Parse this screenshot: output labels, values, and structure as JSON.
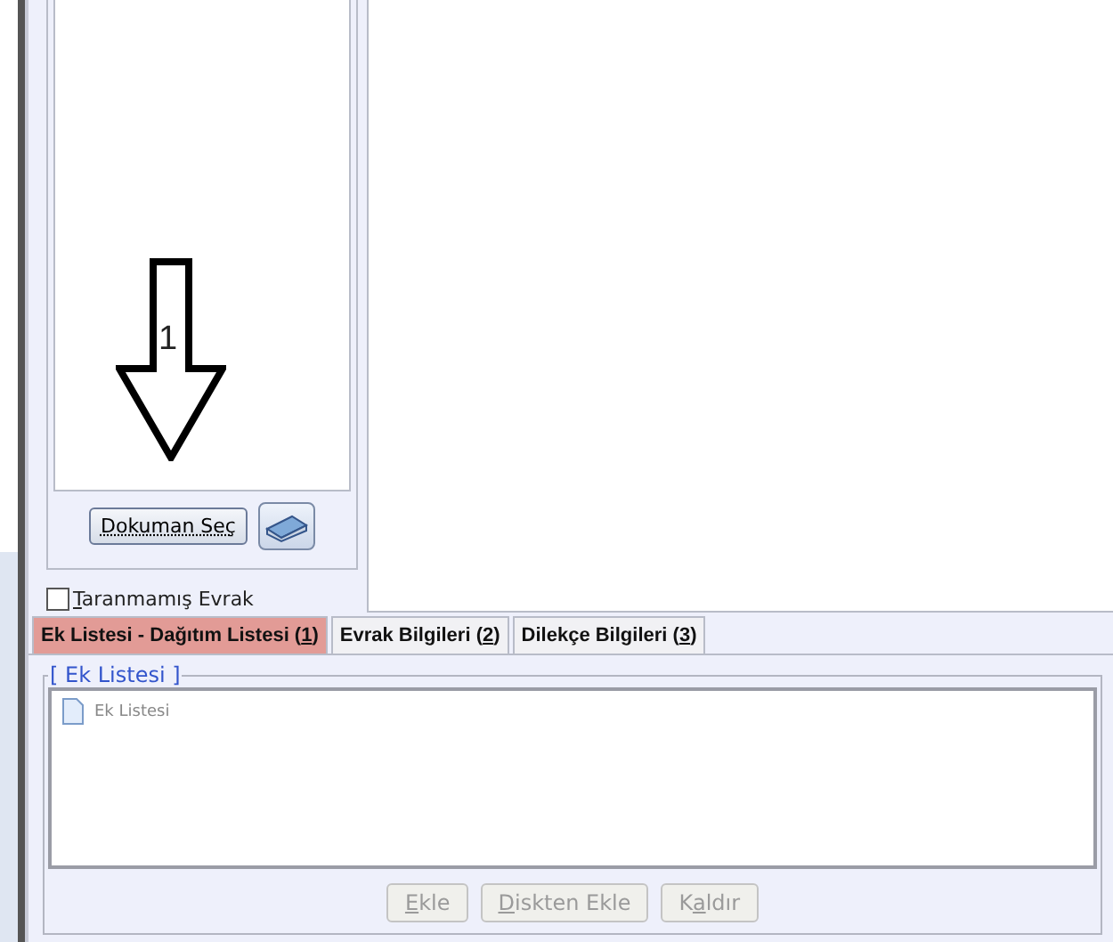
{
  "document_panel": {
    "annotation": {
      "label": "1"
    },
    "choose_button": {
      "label": "Dokuman Seç"
    },
    "unscanned_checkbox": {
      "label": {
        "key": "T",
        "after": "aranmamış Evrak"
      },
      "checked": false
    }
  },
  "tabs": [
    {
      "label": {
        "before": "Ek Listesi - Dağıtım Listesi (",
        "key": "1",
        "after": ")"
      },
      "selected": true
    },
    {
      "label": {
        "before": "Evrak Bilgileri (",
        "key": "2",
        "after": ")"
      },
      "selected": false
    },
    {
      "label": {
        "before": "Dilekçe Bilgileri (",
        "key": "3",
        "after": ")"
      },
      "selected": false
    }
  ],
  "attachments": {
    "title": "[ Ek Listesi ]",
    "tree": [
      {
        "label": "Ek Listesi"
      }
    ],
    "buttons": [
      {
        "label": {
          "key": "E",
          "after": "kle"
        },
        "disabled": true
      },
      {
        "label": {
          "key": "D",
          "after": "iskten Ekle"
        },
        "disabled": true
      },
      {
        "label": {
          "before": "K",
          "key": "a",
          "after": "ldır"
        },
        "disabled": true
      }
    ]
  }
}
